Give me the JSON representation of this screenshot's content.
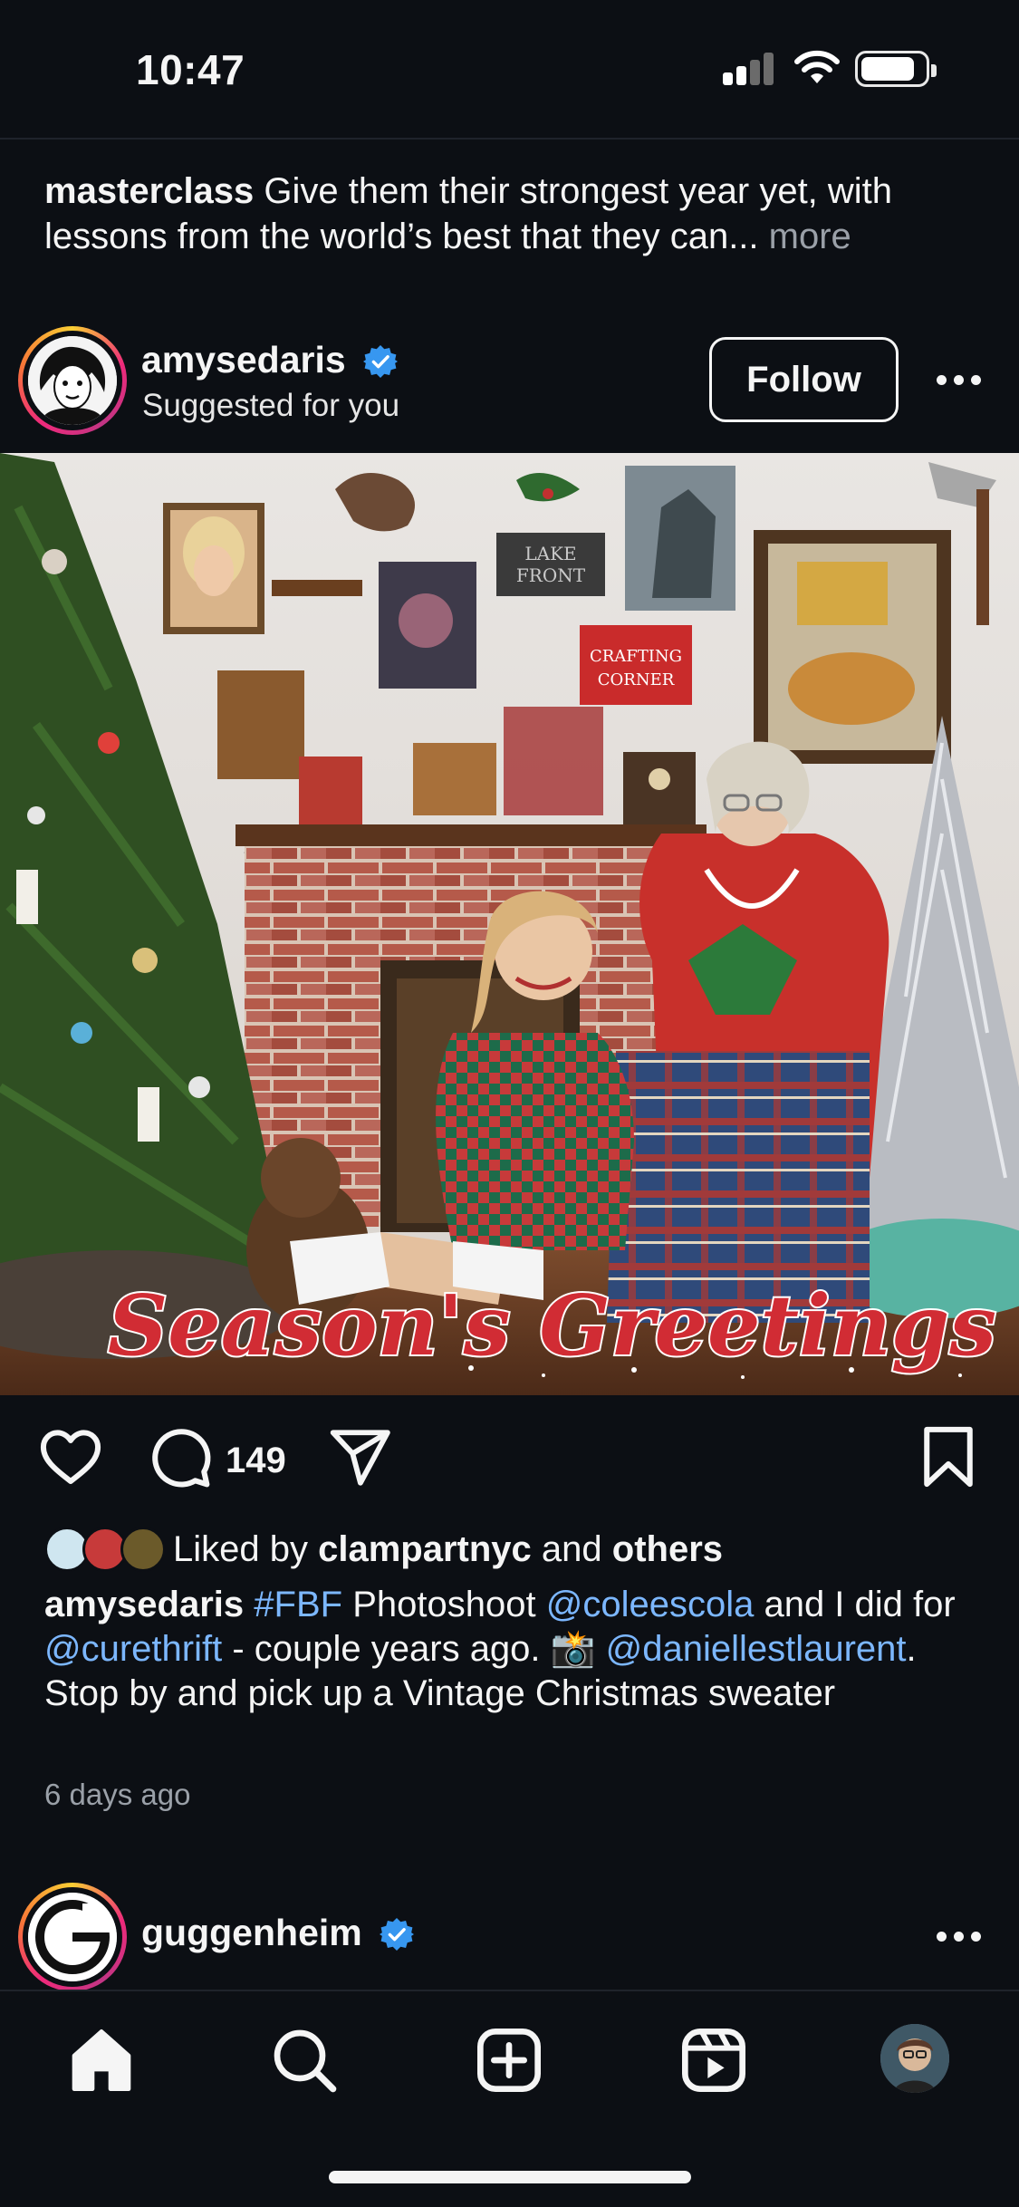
{
  "status_bar": {
    "time": "10:47"
  },
  "previous_post": {
    "username": "masterclass",
    "caption": "Give them their strongest year yet, with lessons from the world’s best that they can...",
    "more_label": "more"
  },
  "post": {
    "username": "amysedaris",
    "subtitle": "Suggested for you",
    "follow_label": "Follow",
    "photo_overlay_text": "Season's Greetings",
    "photo_sign_crafting": "CRAFTING CORNER",
    "photo_sign_lake": "LAKE FRONT",
    "comment_count": "149",
    "likes": {
      "prefix": "Liked by",
      "user": "clampartnyc",
      "joiner": "and",
      "others": "others"
    },
    "caption": {
      "username": "amysedaris",
      "hashtag": "#FBF",
      "text1": "Photoshoot",
      "mention1": "@coleescola",
      "text2": "and I did for",
      "mention2": "@curethrift",
      "text3": "- couple years ago. 📸",
      "mention3": "@daniellestlaurent",
      "text4": ". Stop by and pick up a Vintage Christmas sweater"
    },
    "time_ago": "6 days ago"
  },
  "next_post": {
    "username": "guggenheim"
  },
  "nav": {
    "items": [
      "home-icon",
      "search-icon",
      "create-icon",
      "reels-icon",
      "profile-avatar"
    ]
  },
  "colors": {
    "background": "#0c0f14",
    "link": "#7cb7ff",
    "verified": "#3797f0",
    "muted": "#9aa0a8"
  }
}
